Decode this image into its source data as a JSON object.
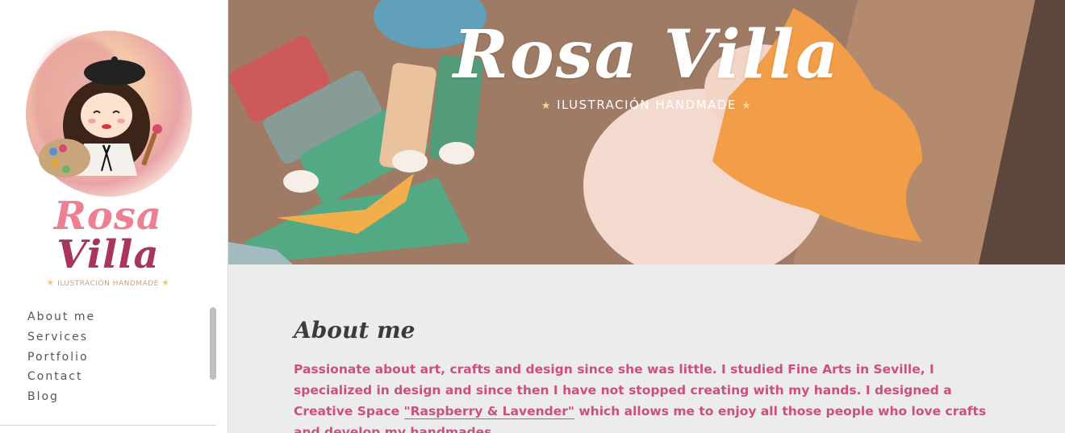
{
  "brand": {
    "logo_line1": "Rosa",
    "logo_line2": "Villa",
    "logo_tagline": "ILUSTRACIÓN HANDMADE"
  },
  "nav": {
    "items": [
      "About me",
      "Services",
      "Portfolio",
      "Contact",
      "Blog"
    ]
  },
  "hero": {
    "title": "Rosa Villa",
    "subtitle": "ILUSTRACIÓN HANDMADE",
    "star": "★"
  },
  "about": {
    "heading": "About me",
    "text_before": "Passionate about art, crafts and design since she was little. I studied Fine Arts in Seville, I specialized in design and since then I have not stopped creating with my hands. I designed a Creative Space ",
    "link_text": "\"Raspberry & Lavender\"",
    "text_after": " which allows me to enjoy all those people who love crafts and develop my handmades."
  },
  "colors": {
    "accent_pink": "#cc4f80",
    "logo_rosa": "#ec7f92",
    "logo_villa": "#a8345f",
    "sidebar_bg": "#ffffff",
    "content_bg": "#ececec"
  }
}
